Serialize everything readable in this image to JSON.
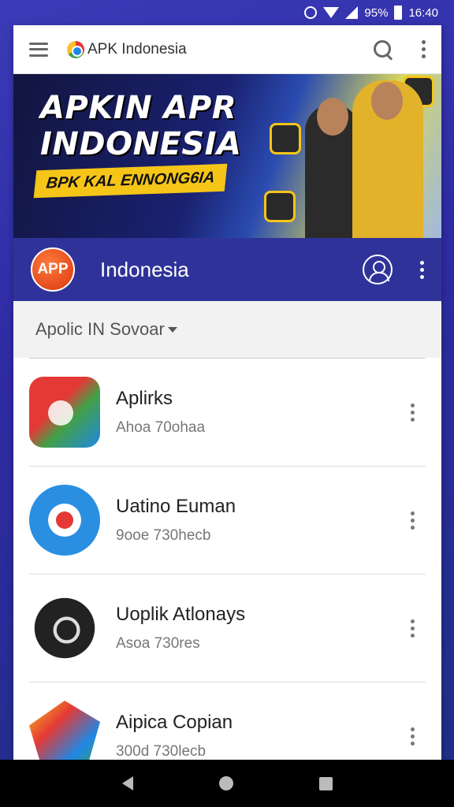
{
  "status_bar": {
    "battery": "95%",
    "time": "16:40"
  },
  "topbar": {
    "title": "APK Indonesia"
  },
  "banner": {
    "title_line1": "APKIN APR",
    "title_line2": "INDONESIA",
    "subtitle": "BPK KAL ENNONG6IA"
  },
  "app_bar": {
    "badge": "APP",
    "title": "Indonesia"
  },
  "filter": {
    "label": "Apolic IN Sovoar"
  },
  "apps": [
    {
      "name": "Aplirks",
      "sub": "Ahoa 70ohaa"
    },
    {
      "name": "Uatino Euman",
      "sub": "9ooe 730hecb"
    },
    {
      "name": "Uoplik Atlonays",
      "sub": "Asoa 730res"
    },
    {
      "name": "Aipica Copian",
      "sub": "300d 730lecb"
    }
  ],
  "colors": {
    "background": "#3a3bb8",
    "app_bar": "#2f3399",
    "banner_accent": "#f5c518",
    "badge": "#d9370f"
  }
}
